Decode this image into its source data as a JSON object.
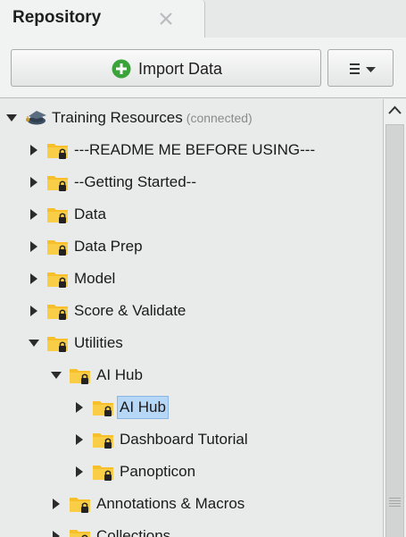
{
  "panel": {
    "tab_title": "Repository"
  },
  "toolbar": {
    "import_label": "Import Data",
    "menu_icon": "hamburger-dropdown-icon"
  },
  "tree": {
    "root": {
      "label": "Training Resources",
      "status": "(connected)"
    },
    "items": [
      {
        "label": "---README ME BEFORE USING---"
      },
      {
        "label": "--Getting Started--"
      },
      {
        "label": "Data"
      },
      {
        "label": "Data Prep"
      },
      {
        "label": "Model"
      },
      {
        "label": "Score & Validate"
      },
      {
        "label": "Utilities"
      },
      {
        "label": "AI Hub"
      },
      {
        "label": "AI Hub"
      },
      {
        "label": "Dashboard Tutorial"
      },
      {
        "label": "Panopticon"
      },
      {
        "label": "Annotations & Macros"
      },
      {
        "label": "Collections"
      }
    ]
  },
  "colors": {
    "folder": "#f7c02a",
    "selection": "#b7d7f6",
    "plus_green": "#3aa33a"
  }
}
